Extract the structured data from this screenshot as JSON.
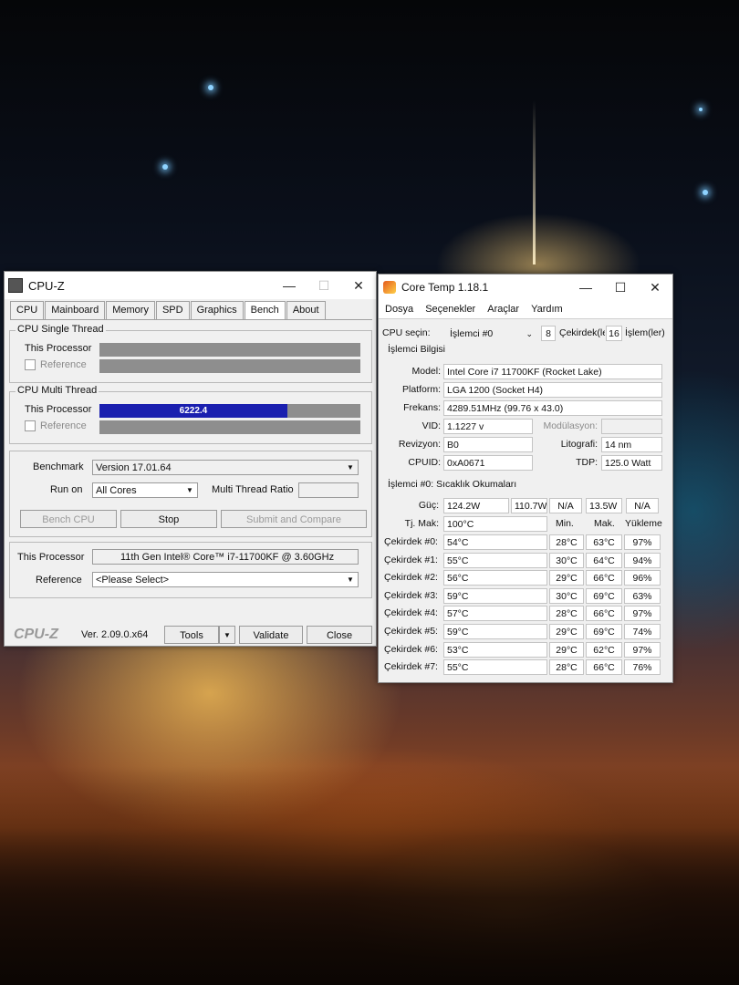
{
  "cpuz": {
    "title": "CPU-Z",
    "tabs": [
      "CPU",
      "Mainboard",
      "Memory",
      "SPD",
      "Graphics",
      "Bench",
      "About"
    ],
    "single_thread": {
      "title": "CPU Single Thread",
      "this_label": "This Processor",
      "ref_label": "Reference"
    },
    "multi_thread": {
      "title": "CPU Multi Thread",
      "this_label": "This Processor",
      "ref_label": "Reference",
      "score": "6222.4",
      "fill_fraction": 0.72
    },
    "benchmark_label": "Benchmark",
    "benchmark_value": "Version 17.01.64",
    "runon_label": "Run on",
    "runon_value": "All Cores",
    "ratio_label": "Multi Thread Ratio",
    "bench_cpu_btn": "Bench CPU",
    "stop_btn": "Stop",
    "submit_btn": "Submit and Compare",
    "this_processor_label": "This Processor",
    "this_processor_value": "11th Gen Intel® Core™ i7-11700KF @ 3.60GHz",
    "reference_label": "Reference",
    "reference_value": "<Please Select>",
    "logo": "CPU-Z",
    "version": "Ver. 2.09.0.x64",
    "tools_btn": "Tools",
    "validate_btn": "Validate",
    "close_btn": "Close"
  },
  "coretemp": {
    "title": "Core Temp 1.18.1",
    "menu": [
      "Dosya",
      "Seçenekler",
      "Araçlar",
      "Yardım"
    ],
    "cpu_select_label": "CPU seçin:",
    "cpu_select_value": "İşlemci #0",
    "cores_count": "8",
    "cores_label": "Çekirdek(le",
    "threads_count": "16",
    "threads_label": "İşlem(ler)",
    "info_title": "İşlemci Bilgisi",
    "model_label": "Model:",
    "model_value": "Intel Core i7 11700KF (Rocket Lake)",
    "platform_label": "Platform:",
    "platform_value": "LGA 1200 (Socket H4)",
    "freq_label": "Frekans:",
    "freq_value": "4289.51MHz (99.76 x 43.0)",
    "vid_label": "VID:",
    "vid_value": "1.1227 v",
    "modulation_label": "Modülasyon:",
    "rev_label": "Revizyon:",
    "rev_value": "B0",
    "litho_label": "Litografi:",
    "litho_value": "14 nm",
    "cpuid_label": "CPUID:",
    "cpuid_value": "0xA0671",
    "tdp_label": "TDP:",
    "tdp_value": "125.0 Watt",
    "readings_title": "İşlemci #0: Sıcaklık Okumaları",
    "power_label": "Güç:",
    "power_values": [
      "124.2W",
      "110.7W",
      "N/A",
      "13.5W",
      "N/A"
    ],
    "tjmax_label": "Tj. Mak:",
    "tjmax_value": "100°C",
    "col_min": "Min.",
    "col_max": "Mak.",
    "col_load": "Yükleme",
    "cores": [
      {
        "label": "Çekirdek #0:",
        "temp": "54°C",
        "min": "28°C",
        "max": "63°C",
        "load": "97%"
      },
      {
        "label": "Çekirdek #1:",
        "temp": "55°C",
        "min": "30°C",
        "max": "64°C",
        "load": "94%"
      },
      {
        "label": "Çekirdek #2:",
        "temp": "56°C",
        "min": "29°C",
        "max": "66°C",
        "load": "96%"
      },
      {
        "label": "Çekirdek #3:",
        "temp": "59°C",
        "min": "30°C",
        "max": "69°C",
        "load": "63%"
      },
      {
        "label": "Çekirdek #4:",
        "temp": "57°C",
        "min": "28°C",
        "max": "66°C",
        "load": "97%"
      },
      {
        "label": "Çekirdek #5:",
        "temp": "59°C",
        "min": "29°C",
        "max": "69°C",
        "load": "74%"
      },
      {
        "label": "Çekirdek #6:",
        "temp": "53°C",
        "min": "29°C",
        "max": "62°C",
        "load": "97%"
      },
      {
        "label": "Çekirdek #7:",
        "temp": "55°C",
        "min": "28°C",
        "max": "66°C",
        "load": "76%"
      }
    ]
  },
  "icons": {
    "minimize": "minimize-icon",
    "maximize": "maximize-icon",
    "close": "close-icon",
    "dropdown": "chevron-down-icon"
  }
}
